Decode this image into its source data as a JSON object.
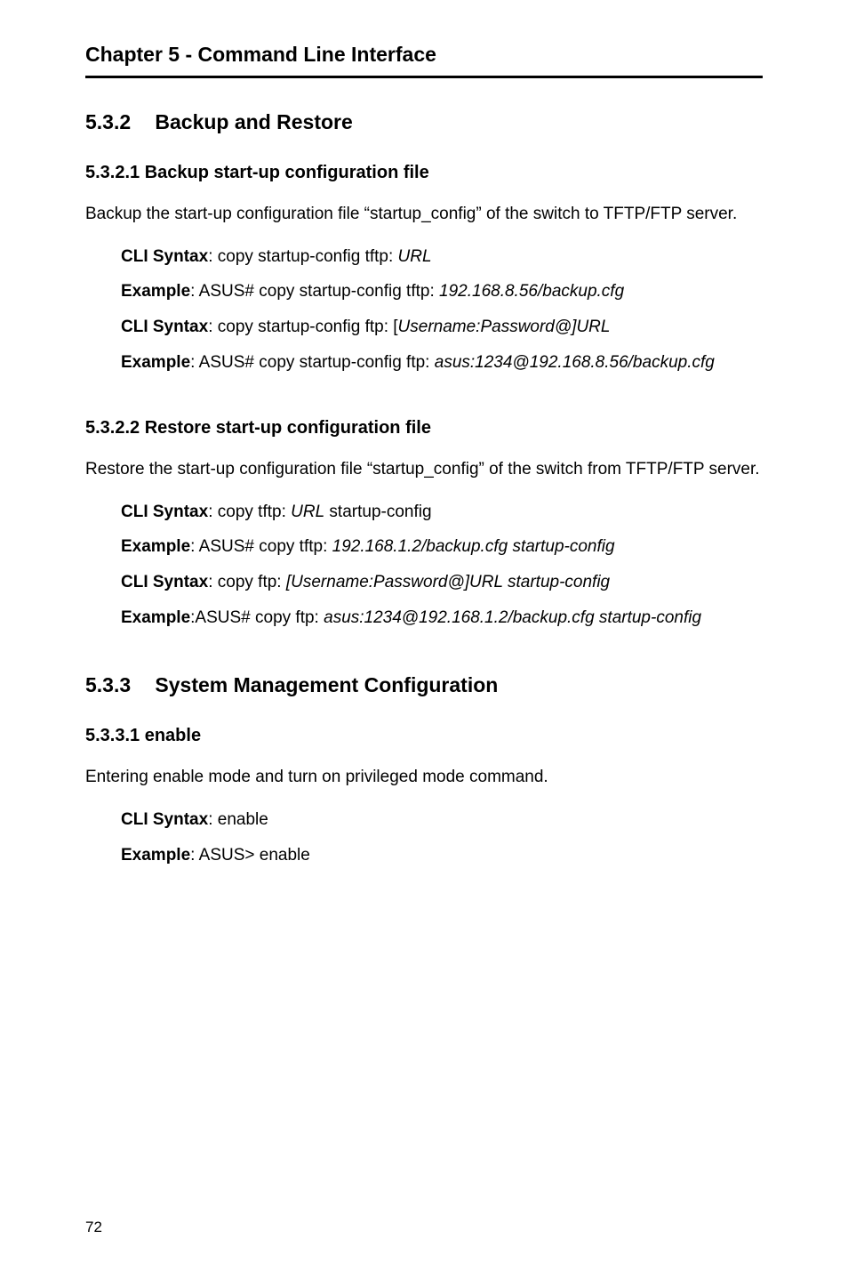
{
  "chapter": {
    "title": "Chapter 5 - Command Line Interface"
  },
  "sec_532": {
    "number": "5.3.2",
    "title": "Backup and Restore"
  },
  "sec_5321": {
    "heading": "5.3.2.1  Backup start-up configuration file",
    "body": "Backup the start-up configuration file “startup_config” of the switch to TFTP/FTP server.",
    "cli1_label": "CLI Syntax",
    "cli1_text": ": copy startup-config tftp: ",
    "cli1_italic": "URL",
    "cli2_label": "Example",
    "cli2_text": ": ASUS# copy startup-config tftp: ",
    "cli2_italic": "192.168.8.56/backup.cfg",
    "cli3_label": "CLI Syntax",
    "cli3_text": ": copy startup-config ftp: [",
    "cli3_italic": "Username:Password@]URL",
    "cli4_label": "Example",
    "cli4_text": ": ASUS# copy startup-config ftp: ",
    "cli4_italic": "asus:1234@192.168.8.56/backup.cfg"
  },
  "sec_5322": {
    "heading": "5.3.2.2  Restore start-up configuration file",
    "body": "Restore the start-up configuration file “startup_config” of the switch from TFTP/FTP server.",
    "cli1_label": "CLI Syntax",
    "cli1_text": ": copy tftp: ",
    "cli1_italic": "URL",
    "cli1_after": " startup-config",
    "cli2_label": "Example",
    "cli2_text": ": ASUS# copy tftp: ",
    "cli2_italic": "192.168.1.2/backup.cfg startup-config",
    "cli3_label": "CLI Syntax",
    "cli3_text": ": copy ftp: ",
    "cli3_italic": "[Username:Password@]URL startup-config",
    "cli4_label": "Example",
    "cli4_text": ":ASUS# copy ftp: ",
    "cli4_italic": "asus:1234@192.168.1.2/backup.cfg startup-config"
  },
  "sec_533": {
    "number": "5.3.3",
    "title": "System Management Configuration"
  },
  "sec_5331": {
    "heading": "5.3.3.1  enable",
    "body": "Entering enable mode and turn on privileged mode command.",
    "cli1_label": "CLI Syntax",
    "cli1_text": ": enable",
    "cli2_label": "Example",
    "cli2_text": ": ASUS> enable"
  },
  "page_number": "72"
}
